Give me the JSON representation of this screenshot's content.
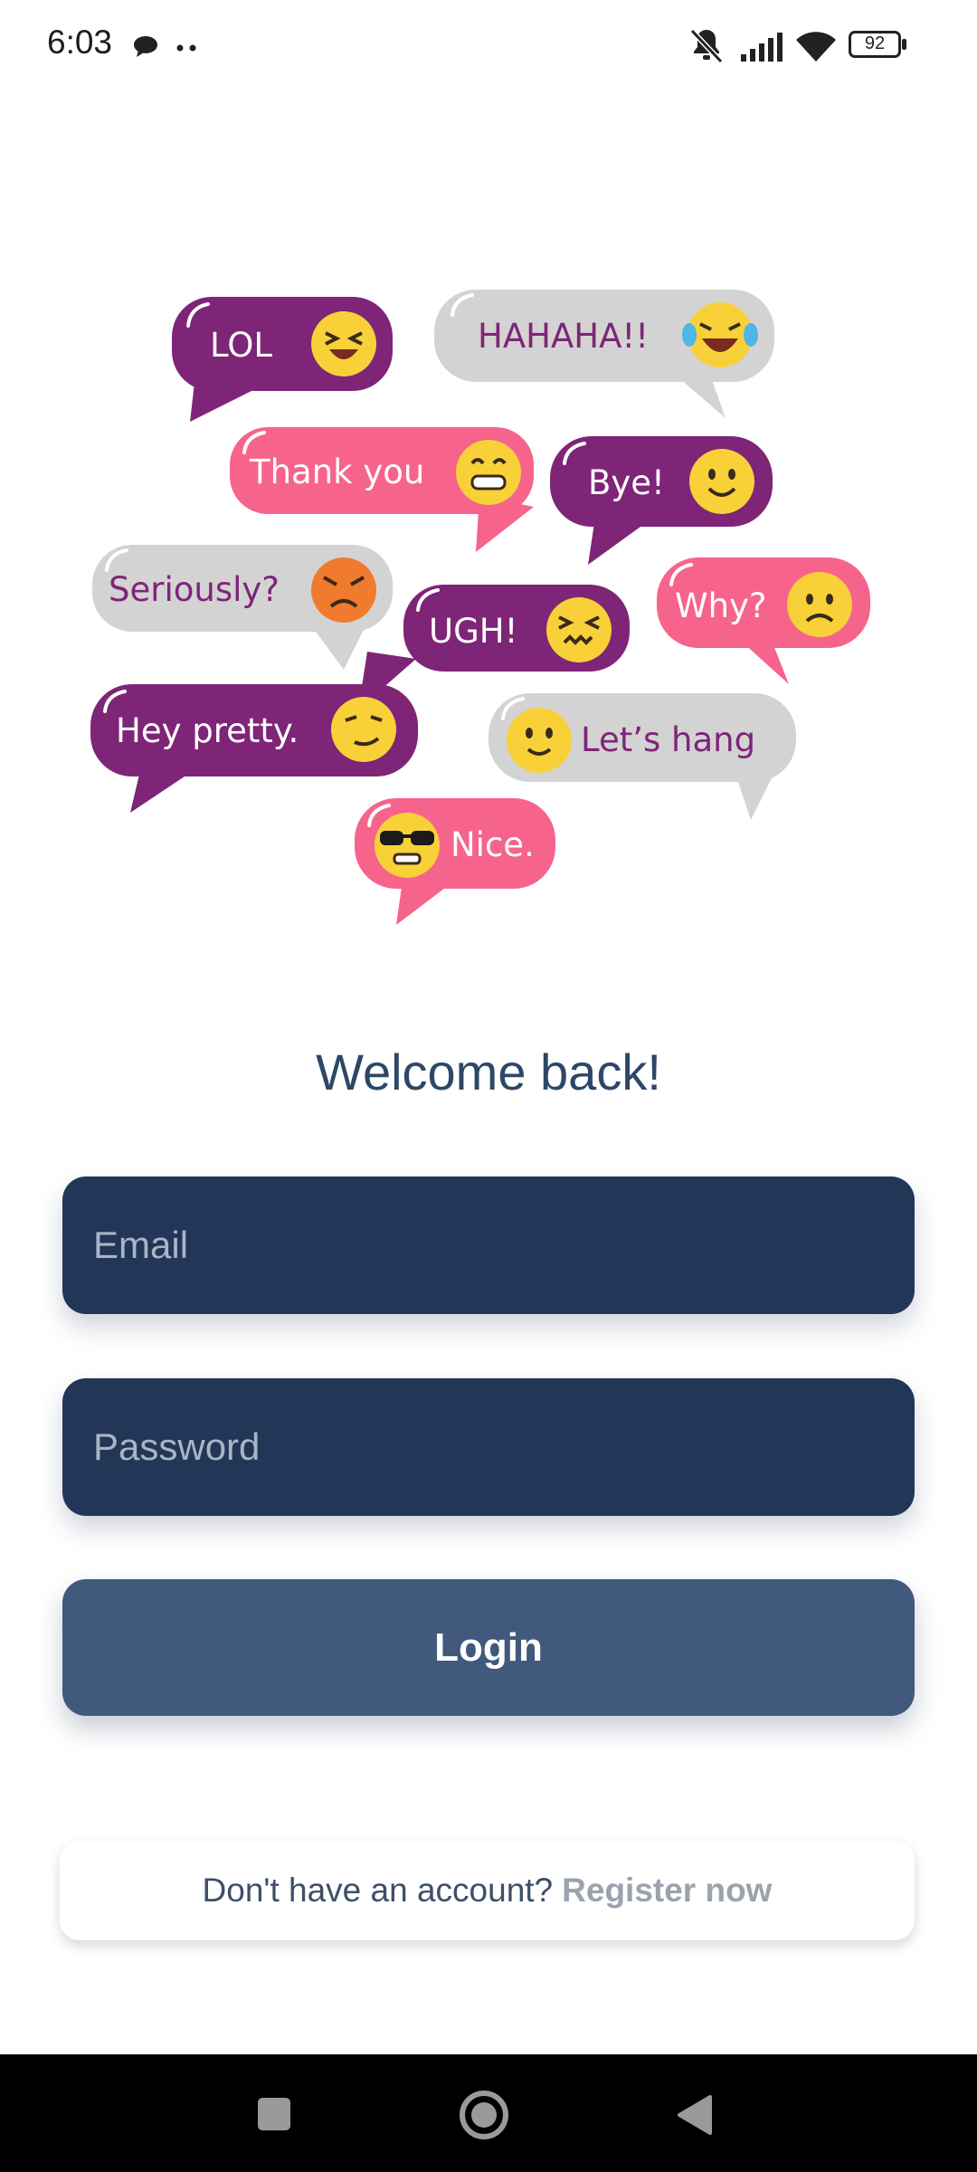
{
  "status_bar": {
    "time": "6:03",
    "battery": "92",
    "icons": [
      "chat-notification-icon",
      "more-dots-icon",
      "mute-icon",
      "signal-icon",
      "wifi-icon",
      "battery-icon"
    ]
  },
  "illustration": {
    "bubbles": [
      {
        "text": "LOL",
        "emoji": "laughing-face"
      },
      {
        "text": "HAHAHA!!",
        "emoji": "tears-of-joy-face"
      },
      {
        "text": "Thank you",
        "emoji": "grinning-face"
      },
      {
        "text": "Bye!",
        "emoji": "smiling-face"
      },
      {
        "text": "Seriously?",
        "emoji": "angry-face"
      },
      {
        "text": "UGH!",
        "emoji": "tired-face"
      },
      {
        "text": "Why?",
        "emoji": "worried-face"
      },
      {
        "text": "Hey pretty.",
        "emoji": "flirty-face"
      },
      {
        "text": "Let’s hang",
        "emoji": "smiling-face"
      },
      {
        "text": "Nice.",
        "emoji": "sunglasses-face"
      }
    ],
    "colors": {
      "purple": "#7e2578",
      "pink": "#f6648c",
      "gray": "#d3d3d3",
      "emoji_yellow": "#f8d138",
      "emoji_orange": "#f07b2f"
    }
  },
  "welcome": {
    "title": "Welcome back!"
  },
  "form": {
    "email_placeholder": "Email",
    "password_placeholder": "Password",
    "login_label": "Login"
  },
  "footer": {
    "prompt": "Don't have an account?",
    "register_label": "Register now"
  },
  "colors": {
    "field_bg": "#223658",
    "button_bg": "#40597c",
    "title_color": "#2d4766",
    "nav_bg": "#000000"
  }
}
